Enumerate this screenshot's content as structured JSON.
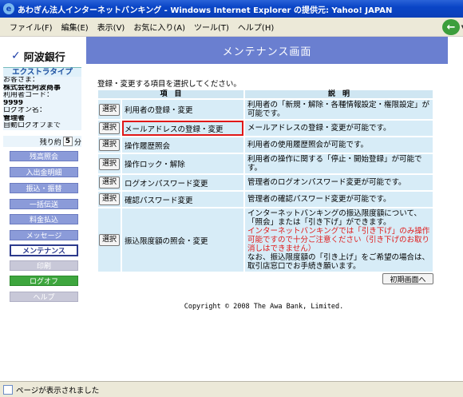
{
  "window": {
    "title": "あわぎん法人インターネットバンキング - Windows Internet Explorer の提供元: Yahoo! JAPAN"
  },
  "menu": {
    "items": [
      "ファイル(F)",
      "編集(E)",
      "表示(V)",
      "お気に入り(A)",
      "ツール(T)",
      "ヘルプ(H)"
    ]
  },
  "sidebar": {
    "bank_name": "阿波銀行",
    "plan": "エクストラタイプ",
    "customer_label": "お客さま：",
    "customer_value": "株式会社阿波商事",
    "userid_label": "利用者コード：",
    "userid_value": "9999",
    "login_label": "ログオン名：",
    "login_value": "管理者",
    "autologout_label": "自動ログオフまで",
    "remaining_label": "残り約",
    "remaining_value": "5",
    "remaining_unit": "分",
    "nav": [
      "残高照会",
      "入出金明細",
      "振込・振替",
      "一括伝送",
      "料金払込",
      "メッセージ",
      "メンテナンス",
      "印刷",
      "ログオフ",
      "ヘルプ"
    ]
  },
  "main": {
    "title": "メンテナンス画面",
    "instruction": "登録・変更する項目を選択してください。",
    "col_item": "項　目",
    "col_desc": "説　明",
    "select_label": "選択",
    "rows": [
      {
        "name": "利用者の登録・変更",
        "desc": "利用者の「新規・解除・各種情報設定・権限設定」が可能です。"
      },
      {
        "name": "メールアドレスの登録・変更",
        "desc": "メールアドレスの登録・変更が可能です。"
      },
      {
        "name": "操作履歴照会",
        "desc": "利用者の使用履歴照会が可能です。"
      },
      {
        "name": "操作ロック・解除",
        "desc": "利用者の操作に関する「停止・開始登録」が可能です。"
      },
      {
        "name": "ログオンパスワード変更",
        "desc": "管理者のログオンパスワード変更が可能です。"
      },
      {
        "name": "確認パスワード変更",
        "desc": "管理者の確認パスワード変更が可能です。"
      },
      {
        "name": "振込限度額の照会・変更",
        "desc1": "インターネットバンキングの振込限度額について、「照会」または「引き下げ」ができます。",
        "desc_warn": "インターネットバンキングでは「引き下げ」のみ操作可能ですので十分ご注意ください（引き下げのお取り消しはできません）",
        "desc2": "なお、振込限度額の「引き上げ」をご希望の場合は、取引店窓口でお手続き願います。"
      }
    ],
    "init_button": "初期画面へ",
    "copyright": "Copyright © 2008 The Awa Bank, Limited."
  },
  "status": {
    "text": "ページが表示されました"
  }
}
